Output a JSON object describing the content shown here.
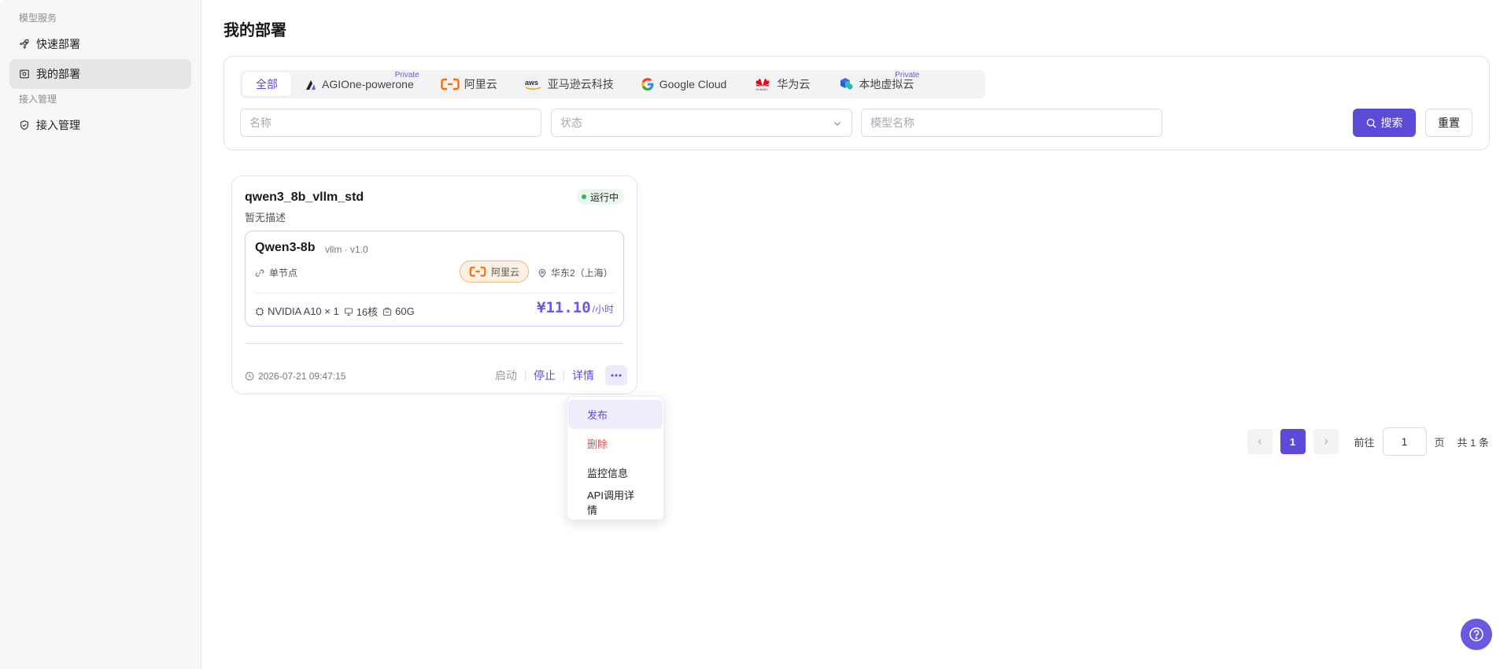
{
  "sidebar": {
    "section1": "模型服务",
    "items1": [
      {
        "label": "快速部署",
        "icon": "rocket-icon"
      },
      {
        "label": "我的部署",
        "icon": "deploy-icon"
      }
    ],
    "section2": "接入管理",
    "items2": [
      {
        "label": "接入管理",
        "icon": "shield-icon"
      }
    ]
  },
  "page": {
    "title": "我的部署"
  },
  "tabs": [
    {
      "label": "全部",
      "active": true
    },
    {
      "label": "AGIOne-powerone",
      "badge": "Private",
      "icon": "agione-logo"
    },
    {
      "label": "阿里云",
      "icon": "aliyun-logo"
    },
    {
      "label": "亚马逊云科技",
      "icon": "aws-logo"
    },
    {
      "label": "Google Cloud",
      "icon": "google-logo"
    },
    {
      "label": "华为云",
      "icon": "huawei-logo"
    },
    {
      "label": "本地虚拟云",
      "badge": "Private",
      "icon": "local-cloud-logo"
    }
  ],
  "filters": {
    "name_placeholder": "名称",
    "status_placeholder": "状态",
    "model_placeholder": "模型名称",
    "search_label": "搜索",
    "reset_label": "重置"
  },
  "card": {
    "name": "qwen3_8b_vllm_std",
    "description": "暂无描述",
    "status": "运行中",
    "model": {
      "name": "Qwen3-8b",
      "meta": "vllm · v1.0",
      "node": "单节点",
      "provider": "阿里云",
      "region": "华东2（上海）",
      "gpu": "NVIDIA A10 × 1",
      "cpu": "16核",
      "memory": "60G",
      "price": "¥11.10",
      "price_unit": "/小时"
    },
    "time": "2026-07-21 09:47:15",
    "actions": {
      "start": "启动",
      "stop": "停止",
      "detail": "详情"
    }
  },
  "dropdown": [
    "发布",
    "删除",
    "监控信息",
    "API调用详情"
  ],
  "pagination": {
    "current": "1",
    "goto_label": "前往",
    "goto_value": "1",
    "page_suffix": "页",
    "total": "共 1 条"
  },
  "colors": {
    "accent": "#5b4bd8",
    "running": "#32b552",
    "danger": "#f24b4b",
    "aliyun": "#ff6a00"
  }
}
